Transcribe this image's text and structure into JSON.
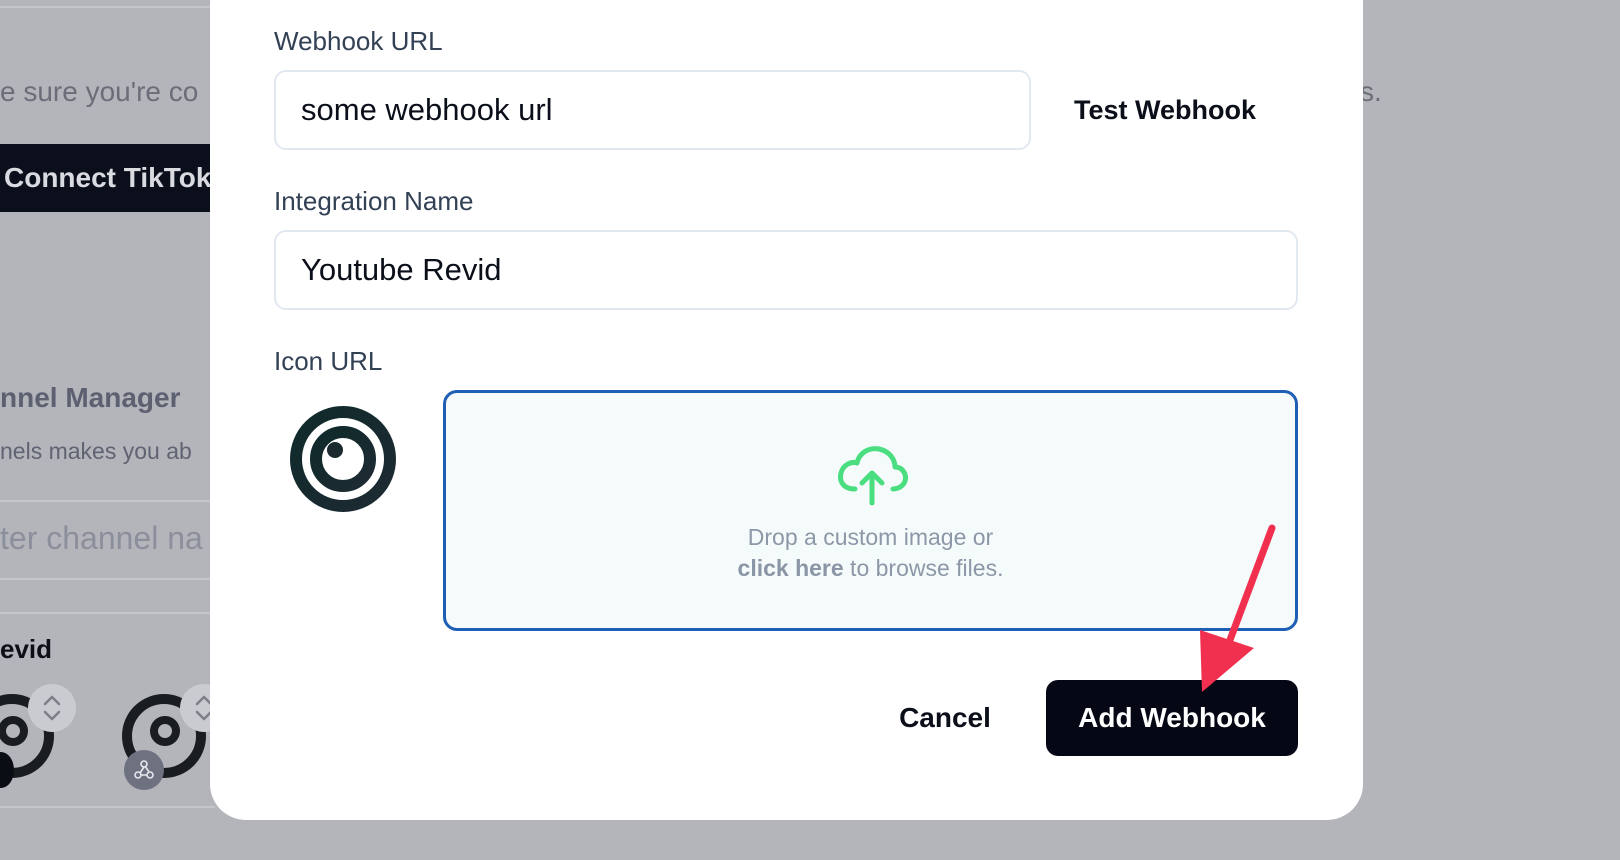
{
  "background": {
    "partial_sentence": "e sure you're co",
    "sentence_end": "s.",
    "connect_button": "Connect TikTok",
    "channel_manager_title": "nnel Manager",
    "channel_manager_desc": "nels makes you ab",
    "channel_input_placeholder": "ter channel na",
    "channel_name": "evid"
  },
  "modal": {
    "webhook_url_label": "Webhook URL",
    "webhook_url_value": "some webhook url",
    "test_webhook_label": "Test Webhook",
    "integration_name_label": "Integration Name",
    "integration_name_value": "Youtube Revid",
    "icon_url_label": "Icon URL",
    "dropzone": {
      "line1": "Drop a custom image or",
      "link_text": "click here",
      "line2_rest": " to browse files.",
      "icon": "cloud-upload-icon",
      "icon_color": "#4ade80"
    },
    "cancel_label": "Cancel",
    "add_webhook_label": "Add Webhook"
  },
  "colors": {
    "primary_button": "#050814",
    "dropzone_border": "#1e5eb5",
    "annotation_arrow": "#f0304e",
    "overlay": "#b3b5bb"
  }
}
